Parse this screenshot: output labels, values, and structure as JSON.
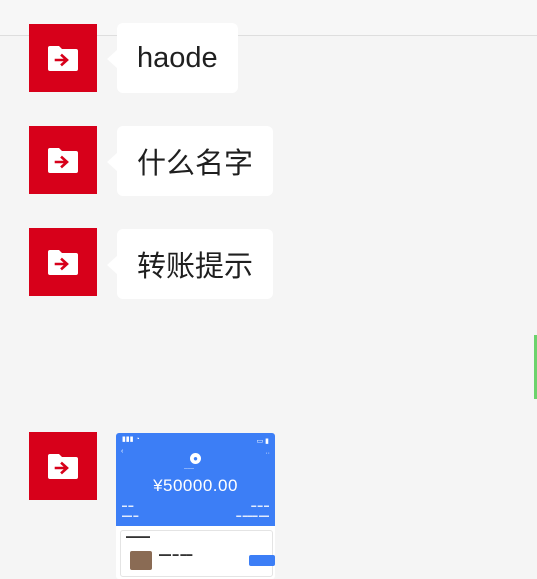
{
  "messages": [
    {
      "text": "haode",
      "avatar_icon": "folder-arrow-icon"
    },
    {
      "text": "什么名字",
      "avatar_icon": "folder-arrow-icon"
    },
    {
      "text": "转账提示",
      "avatar_icon": "folder-arrow-icon"
    }
  ],
  "image_message": {
    "avatar_icon": "folder-arrow-icon",
    "screenshot": {
      "amount": "¥50000.00"
    }
  },
  "colors": {
    "avatar_bg": "#d7001a",
    "bubble_bg": "#ffffff",
    "page_bg": "#f5f5f5",
    "screenshot_blue": "#3c7ef6"
  }
}
